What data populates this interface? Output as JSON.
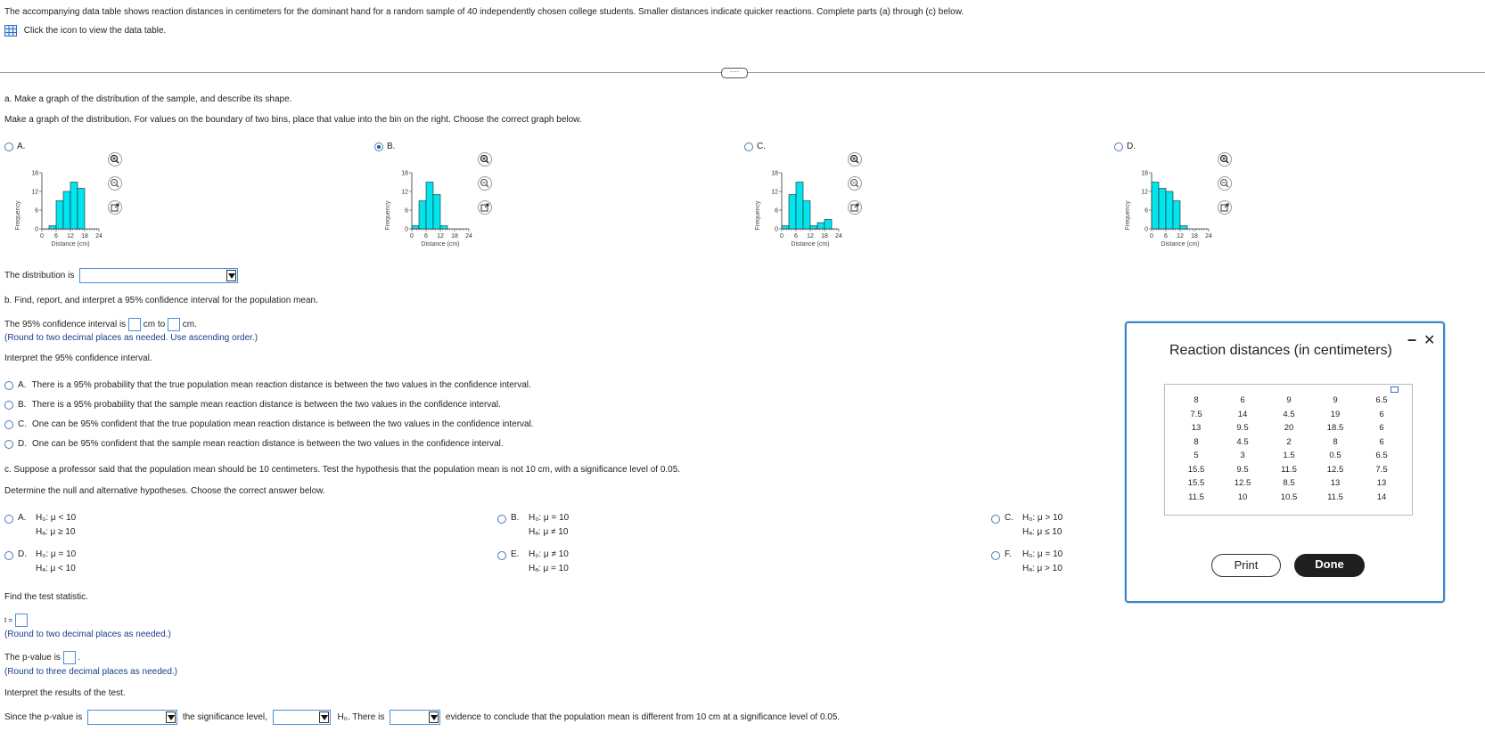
{
  "intro": "The accompanying data table shows reaction distances in centimeters for the dominant hand for a random sample of 40 independently chosen college students. Smaller distances indicate quicker reactions. Complete parts (a) through (c) below.",
  "table_link": "Click the icon to view the data table.",
  "expand_label": "····",
  "part_a": {
    "question": "a. Make a graph of the distribution of the sample, and describe its shape.",
    "instruction": "Make a graph of the distribution. For values on the boundary of two bins, place that value into the bin on the right. Choose the correct graph below.",
    "selected": "B",
    "options": [
      {
        "label": "A.",
        "bins": [
          0,
          1,
          9,
          12,
          15,
          13,
          0,
          0
        ]
      },
      {
        "label": "B.",
        "bins": [
          1,
          9,
          15,
          11,
          1,
          0,
          0,
          0
        ]
      },
      {
        "label": "C.",
        "bins": [
          1,
          11,
          15,
          9,
          1,
          2,
          3,
          0
        ]
      },
      {
        "label": "D.",
        "bins": [
          15,
          13,
          12,
          9,
          1,
          0,
          0,
          0
        ]
      }
    ],
    "chart": {
      "ylabel": "Frequency",
      "xlabel": "Distance (cm)",
      "yticks": [
        "18",
        "12",
        "6",
        "0"
      ],
      "xticks": [
        "0",
        "6",
        "12",
        "18",
        "24"
      ],
      "bar_color": "#00e5ee"
    },
    "shape_prefix": "The distribution is"
  },
  "part_b": {
    "question": "b. Find, report, and interpret a 95% confidence interval for the population mean.",
    "ci_prefix": "The 95% confidence interval is",
    "ci_mid": "cm to",
    "ci_suffix": "cm.",
    "ci_hint": "(Round to two decimal places as needed. Use ascending order.)",
    "interpret_label": "Interpret the 95% confidence interval.",
    "choices": [
      {
        "label": "A.",
        "text": "There is a 95% probability that the true population mean reaction distance is between the two values in the confidence interval."
      },
      {
        "label": "B.",
        "text": "There is a 95% probability that the sample mean reaction distance is between the two values in the confidence interval."
      },
      {
        "label": "C.",
        "text": "One can be 95% confident that the true population mean reaction distance is between the two values in the confidence interval."
      },
      {
        "label": "D.",
        "text": "One can be 95% confident that the sample mean reaction distance is between the two values in the confidence interval."
      }
    ]
  },
  "part_c": {
    "question": "c. Suppose a professor said that the population mean should be 10 centimeters. Test the hypothesis that the population mean is not 10 cm, with a significance level of 0.05.",
    "instruction": "Determine the null and alternative hypotheses. Choose the correct answer below.",
    "hypotheses": [
      {
        "label": "A.",
        "h0": "H₀: μ < 10",
        "ha": "Hₐ: μ ≥ 10"
      },
      {
        "label": "B.",
        "h0": "H₀: μ = 10",
        "ha": "Hₐ: μ ≠ 10"
      },
      {
        "label": "C.",
        "h0": "H₀: μ > 10",
        "ha": "Hₐ: μ ≤ 10"
      },
      {
        "label": "D.",
        "h0": "H₀: μ = 10",
        "ha": "Hₐ: μ < 10"
      },
      {
        "label": "E.",
        "h0": "H₀: μ ≠ 10",
        "ha": "Hₐ: μ = 10"
      },
      {
        "label": "F.",
        "h0": "H₀: μ = 10",
        "ha": "Hₐ: μ > 10"
      }
    ],
    "test_stat_label": "Find the test statistic.",
    "t_prefix": "t =",
    "t_hint": "(Round to two decimal places as needed.)",
    "p_prefix": "The p-value is",
    "p_suffix": ".",
    "p_hint": "(Round to three decimal places as needed.)",
    "interpret_label": "Interpret the results of the test.",
    "s_since": "Since the p-value is",
    "s_sig": "the significance level,",
    "s_h0": "H₀. There is",
    "s_end": "evidence to conclude that the population mean is different from 10 cm at a significance level of 0.05."
  },
  "dialog": {
    "title": "Reaction distances (in centimeters)",
    "minimize": "–",
    "close": "✕",
    "columns": [
      [
        "8",
        "7.5",
        "13",
        "8",
        "5",
        "15.5",
        "15.5",
        "11.5"
      ],
      [
        "6",
        "14",
        "9.5",
        "4.5",
        "3",
        "9.5",
        "12.5",
        "10"
      ],
      [
        "9",
        "4.5",
        "20",
        "2",
        "1.5",
        "11.5",
        "8.5",
        "10.5"
      ],
      [
        "9",
        "19",
        "18.5",
        "8",
        "0.5",
        "12.5",
        "13",
        "11.5"
      ],
      [
        "6.5",
        "6",
        "6",
        "6",
        "6.5",
        "7.5",
        "13",
        "14"
      ]
    ],
    "print_label": "Print",
    "done_label": "Done"
  }
}
